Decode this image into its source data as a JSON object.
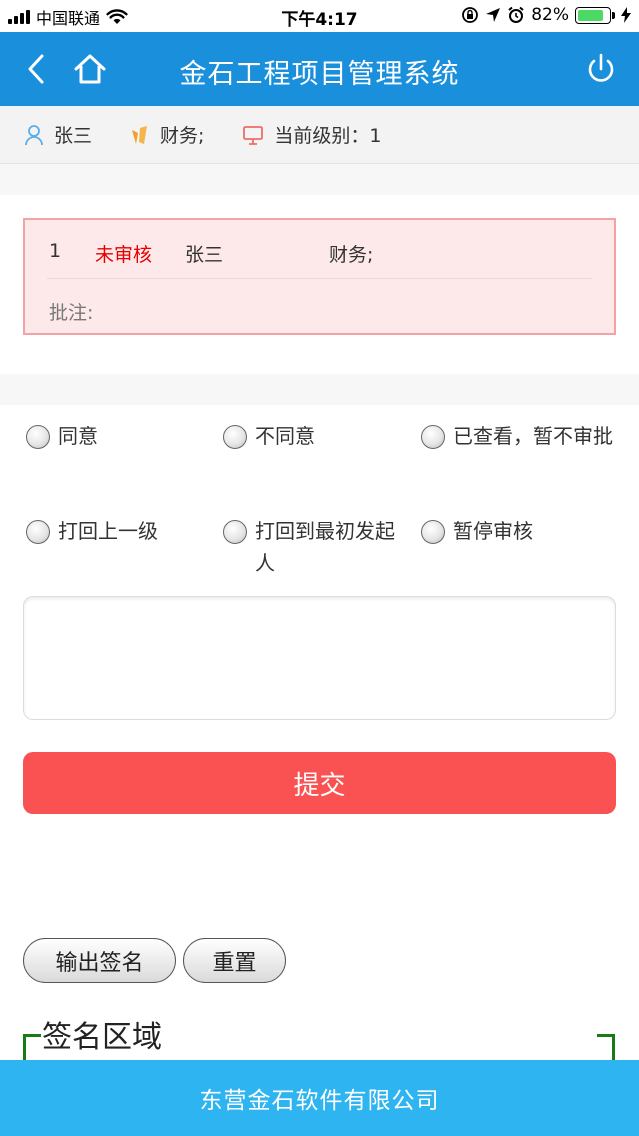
{
  "status_bar": {
    "carrier": "中国联通",
    "time": "下午4:17",
    "battery_percent": "82%",
    "battery_level": 0.82
  },
  "header": {
    "title": "金石工程项目管理系统"
  },
  "user_info": {
    "name": "张三",
    "role": "财务;",
    "level_label": "当前级别：1"
  },
  "record": {
    "index": "1",
    "status": "未审核",
    "status_color": "#e60000",
    "name": "张三",
    "role": "财务;",
    "note_label": "批注:"
  },
  "options": [
    "同意",
    "不同意",
    "已查看，暂不审批",
    "打回上一级",
    "打回到最初发起人",
    "暂停审核"
  ],
  "remark": {
    "value": ""
  },
  "submit_label": "提交",
  "signature": {
    "output_label": "输出签名",
    "reset_label": "重置",
    "area_title": "签名区域"
  },
  "footer": {
    "company": "东营金石软件有限公司"
  },
  "colors": {
    "header": "#1a8fdc",
    "submit": "#fa5252",
    "footer": "#2eb4f0",
    "card_bg": "#fde9e9",
    "card_border": "#f3a3a3"
  }
}
